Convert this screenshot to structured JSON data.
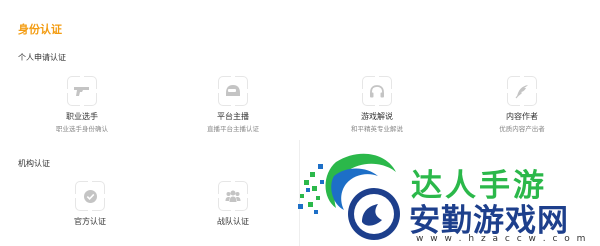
{
  "page": {
    "title": "身份认证"
  },
  "sections": {
    "personal": {
      "title": "个人申请认证",
      "items": [
        {
          "label": "职业选手",
          "desc": "职业选手身份确认",
          "icon": "gun-icon"
        },
        {
          "label": "平台主播",
          "desc": "直播平台主播认证",
          "icon": "helmet-icon"
        },
        {
          "label": "游戏解说",
          "desc": "和平精英专业解说",
          "icon": "headset-icon"
        },
        {
          "label": "内容作者",
          "desc": "优质内容产出者",
          "icon": "feather-pen-icon"
        }
      ]
    },
    "org": {
      "title": "机构认证",
      "items": [
        {
          "label": "官方认证",
          "icon": "verified-check-icon"
        },
        {
          "label": "战队认证",
          "icon": "team-icon"
        }
      ]
    }
  },
  "watermark": {
    "brand": "达人手游",
    "name": "安勤游戏网",
    "url": "w w w . h z a c c w . c o m",
    "colors": {
      "brand": "#2bb84a",
      "name": "#1d3f8c"
    }
  },
  "colors": {
    "accent": "#f39c12",
    "icon": "#c8c8c8",
    "border": "#e6e6e6"
  }
}
